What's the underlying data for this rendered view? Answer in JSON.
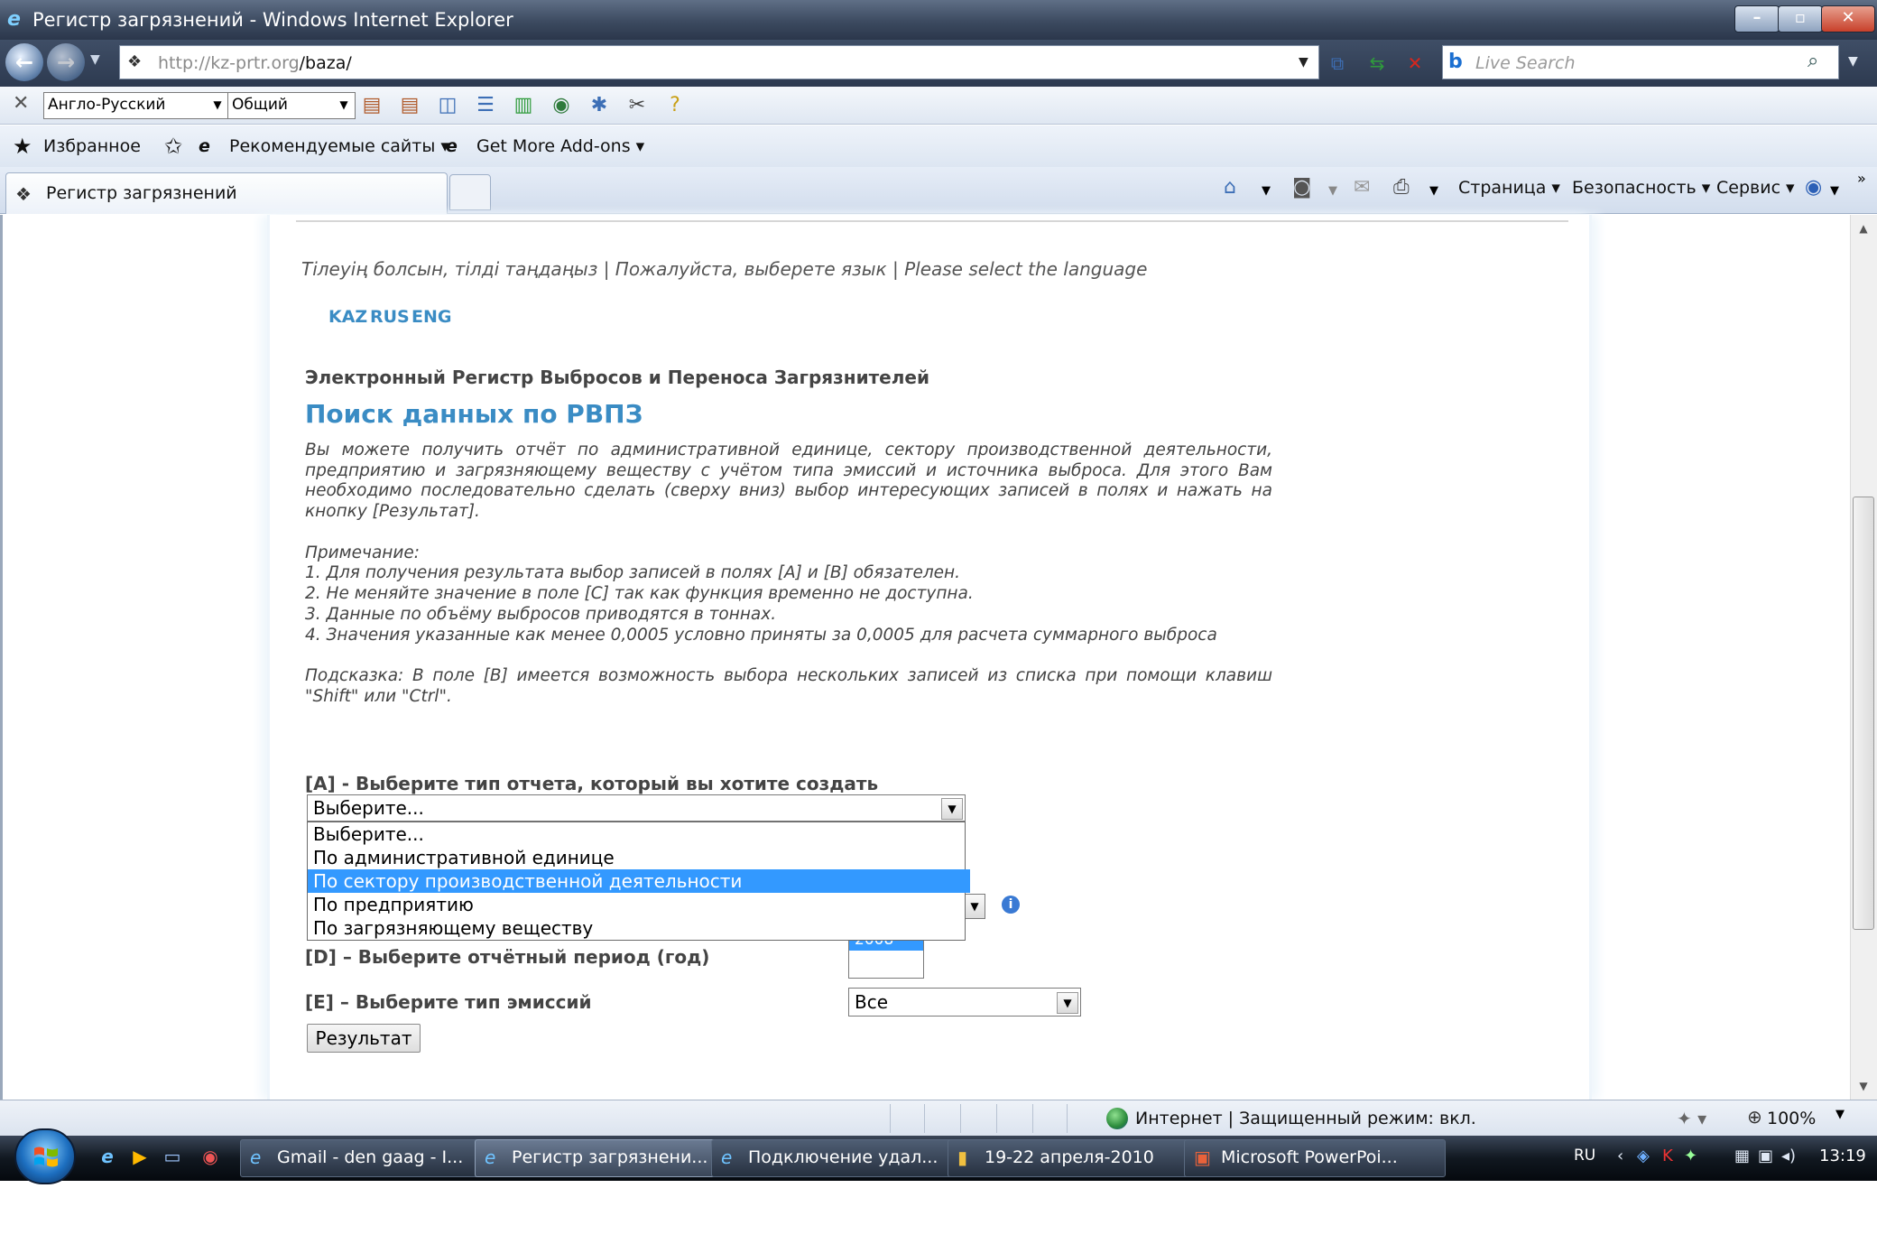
{
  "window": {
    "title": "Регистр загрязнений - Windows Internet Explorer"
  },
  "address_bar": {
    "url_host": "http://kz-prtr.org",
    "url_path": "/baza/",
    "search_placeholder": "Live Search"
  },
  "translation_toolbar": {
    "language_pair": "Англо-Русский",
    "topic": "Общий"
  },
  "favorites_bar": {
    "favorites_label": "Избранное",
    "recommended_label": "Рекомендуемые сайты ▾",
    "addons_label": "Get More Add-ons ▾"
  },
  "tabs": {
    "active_tab_label": "Регистр загрязнений"
  },
  "command_bar": {
    "page_label": "Страница ▾",
    "safety_label": "Безопасность ▾",
    "tools_label": "Сервис ▾"
  },
  "page": {
    "language_prompt": "Тілеуің болсын, тілді таңдаңыз | Пожалуйста, выберете язык | Please select the language",
    "languages": [
      "KAZ",
      "RUS",
      "ENG"
    ],
    "register_title": "Электронный Регистр Выбросов и Переноса Загрязнителей",
    "search_title": "Поиск данных по РВПЗ",
    "intro": "Вы можете получить отчёт по административной единице, сектору производственной деятельности, предприятию и загрязняющему веществу с учётом типа эмиссий и источника выброса. Для этого Вам необходимо последовательно сделать (сверху вниз) выбор интересующих записей в полях и нажать на кнопку [Результат].",
    "note_heading": "Примечание:",
    "notes": [
      "1. Для получения результата выбор записей в полях [A] и [B] обязателен.",
      "2. Не меняйте значение в поле [C] так как функция временно не доступна.",
      "3. Данные по объёму выбросов приводятся в тоннах.",
      "4. Значения указанные как менее 0,0005 условно приняты за 0,0005 для расчета суммарного выброса"
    ],
    "hint": "Подсказка: В поле [B] имеется возможность выбора нескольких записей из списка при помощи клавиш \"Shift\" или \"Ctrl\".",
    "field_a_label": "[A] - Выберите тип отчета, который вы хотите создать",
    "field_a_value": "Выберите...",
    "field_a_options": [
      "Выберите...",
      "По административной единице",
      "По сектору производственной деятельности",
      "По предприятию",
      "По загрязняющему веществу"
    ],
    "field_a_highlighted_index": 2,
    "field_d_label": "[D] – Выберите отчётный период (год)",
    "field_d_visible_year": "2008",
    "field_e_label": "[E] – Выберите тип эмиссий",
    "field_e_value": "Все",
    "result_button": "Результат"
  },
  "status_bar": {
    "zone_text": "Интернет | Защищенный режим: вкл.",
    "zoom": "100%"
  },
  "taskbar": {
    "tasks": [
      "Gmail - den gaag - I...",
      "Регистр загрязнени...",
      "Подключение удал...",
      "19-22 апреля-2010",
      "Microsoft PowerPoi..."
    ],
    "active_task_index": 1,
    "input_language": "RU",
    "clock": "13:19"
  },
  "colors": {
    "accent_blue": "#3a8cc4",
    "selection_blue": "#3399ff"
  }
}
